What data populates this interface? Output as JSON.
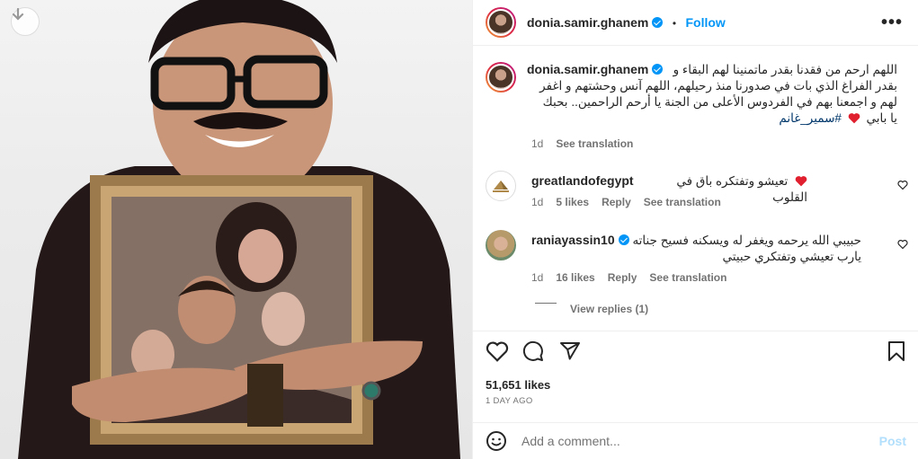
{
  "post": {
    "author": "donia.samir.ghanem",
    "follow_label": "Follow",
    "separator": "•",
    "more_label": "•••",
    "caption_line1": "اللهم ارحم من فقدنا بقدر ماتمنينا لهم البقاء و",
    "caption_line2": "بقدر الفراغ الذي بات في صدورنا منذ رحيلهم، اللهم آنس وحشتهم و اغفر",
    "caption_line3": "لهم و اجمعنا بهم في الفردوس الأعلى من الجنة يا أرحم الراحمين.. بحبك",
    "caption_line4_text": "يا بابي",
    "caption_hashtag": "#سمير_غانم",
    "caption_age": "1d",
    "see_translation": "See translation"
  },
  "comments": [
    {
      "user": "greatlandofegypt",
      "text": "تعيشو وتفتكره باق في القلوب",
      "age": "1d",
      "likes": "5 likes",
      "reply": "Reply",
      "translate": "See translation"
    },
    {
      "user": "raniayassin10",
      "text_line1": "حبيبي الله يرحمه ويغفر له ويسكنه فسيح جناته",
      "text_line2": "يارب تعيشي وتفتكري حبيتي",
      "age": "1d",
      "likes": "16 likes",
      "reply": "Reply",
      "translate": "See translation",
      "view_replies": "View replies (1)"
    }
  ],
  "actions": {
    "likes": "51,651 likes",
    "time": "1 DAY AGO"
  },
  "composer": {
    "placeholder": "Add a comment...",
    "post_label": "Post"
  },
  "colors": {
    "accent": "#0095f6",
    "heart": "#ed4956",
    "post_disabled": "#b2dffc"
  },
  "icons": [
    "download-icon",
    "verified-icon",
    "more-icon",
    "heart-icon",
    "comment-icon",
    "share-icon",
    "save-icon",
    "emoji-icon"
  ]
}
